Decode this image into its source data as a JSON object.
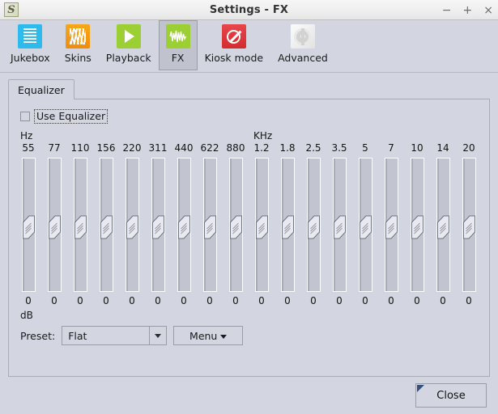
{
  "window": {
    "title": "Settings - FX",
    "app_icon": "S",
    "controls": {
      "minimize": "−",
      "maximize": "+",
      "close": "×"
    }
  },
  "toolbar": {
    "items": [
      {
        "label": "Jukebox",
        "icon": "jukebox-list-icon",
        "active": false
      },
      {
        "label": "Skins",
        "icon": "skins-stripes-icon",
        "active": false
      },
      {
        "label": "Playback",
        "icon": "playback-play-icon",
        "active": false
      },
      {
        "label": "FX",
        "icon": "fx-waveform-icon",
        "active": true
      },
      {
        "label": "Kiosk mode",
        "icon": "kiosk-forbidden-icon",
        "active": false
      },
      {
        "label": "Advanced",
        "icon": "advanced-gear-icon",
        "active": false
      }
    ]
  },
  "tabs": [
    {
      "label": "Equalizer",
      "selected": true
    }
  ],
  "equalizer": {
    "use_equalizer_label": "Use Equalizer",
    "use_equalizer_checked": false,
    "unit_left": "Hz",
    "unit_right": "KHz",
    "db_label": "dB",
    "bands": [
      {
        "freq": "55",
        "value": "0"
      },
      {
        "freq": "77",
        "value": "0"
      },
      {
        "freq": "110",
        "value": "0"
      },
      {
        "freq": "156",
        "value": "0"
      },
      {
        "freq": "220",
        "value": "0"
      },
      {
        "freq": "311",
        "value": "0"
      },
      {
        "freq": "440",
        "value": "0"
      },
      {
        "freq": "622",
        "value": "0"
      },
      {
        "freq": "880",
        "value": "0"
      },
      {
        "freq": "1.2",
        "value": "0"
      },
      {
        "freq": "1.8",
        "value": "0"
      },
      {
        "freq": "2.5",
        "value": "0"
      },
      {
        "freq": "3.5",
        "value": "0"
      },
      {
        "freq": "5",
        "value": "0"
      },
      {
        "freq": "7",
        "value": "0"
      },
      {
        "freq": "10",
        "value": "0"
      },
      {
        "freq": "14",
        "value": "0"
      },
      {
        "freq": "20",
        "value": "0"
      }
    ],
    "preset_label": "Preset:",
    "preset_value": "Flat",
    "menu_label": "Menu"
  },
  "footer": {
    "close_label": "Close"
  },
  "colors": {
    "window_bg": "#d3d6e0",
    "titlebar_bg": "#f1f1f1",
    "accent_jukebox": "#2cbbec",
    "accent_skins": "#f4980f",
    "accent_playback": "#9ccf33",
    "accent_fx": "#9ccf33",
    "accent_kiosk": "#d8383d",
    "default_button_marker": "#35517a"
  }
}
